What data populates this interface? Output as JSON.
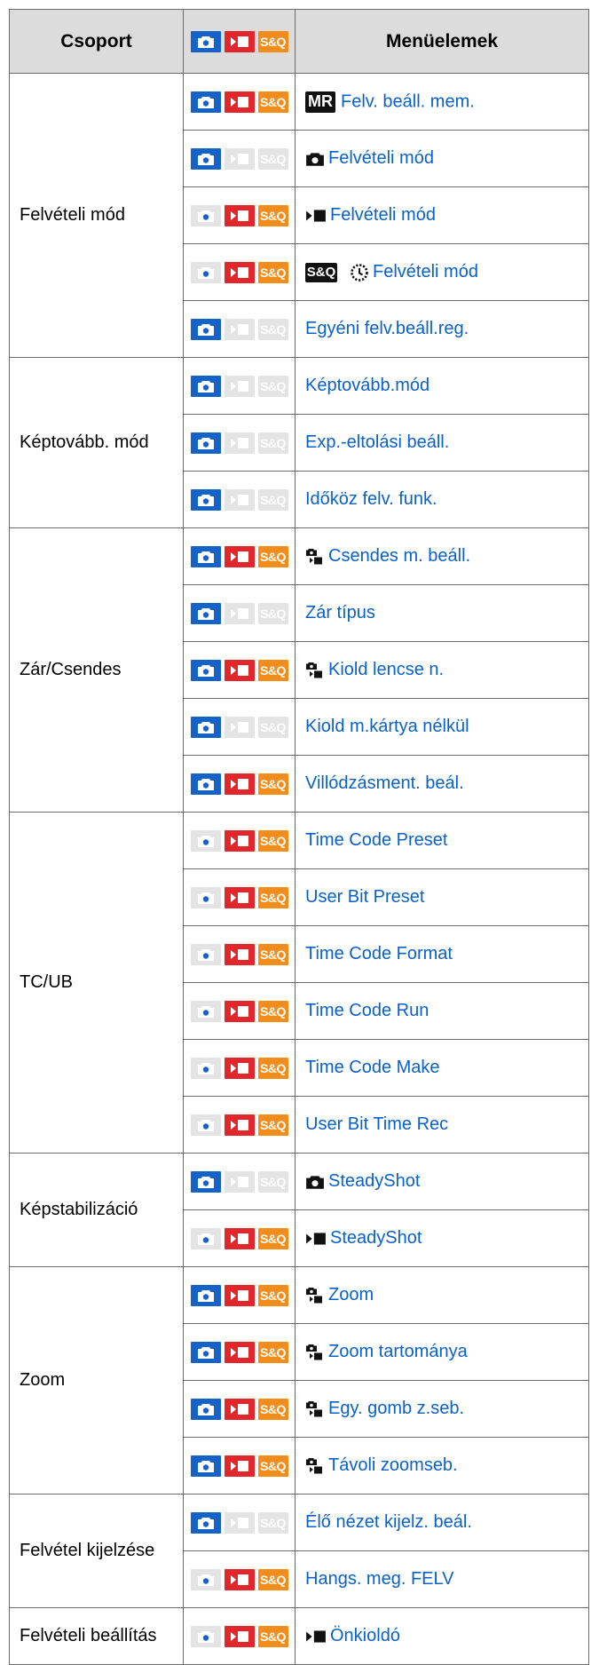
{
  "header": {
    "group": "Csoport",
    "modes": [
      "camera-icon",
      "movie-icon",
      "S&Q"
    ],
    "items": "Menüelemek"
  },
  "mode_colors": {
    "photo": "#1563c8",
    "movie": "#e3262b",
    "sq": "#f28c1a",
    "inactive": "#e4e4e4"
  },
  "groups": [
    {
      "label": "Felvételi mód",
      "rows": [
        {
          "modes": [
            true,
            true,
            true
          ],
          "prefix": [
            "MR"
          ],
          "text": "Felv. beáll. mem."
        },
        {
          "modes": [
            true,
            false,
            false
          ],
          "prefix": [
            "camera-icon"
          ],
          "text": "Felvételi mód"
        },
        {
          "modes": [
            false,
            true,
            true
          ],
          "prefix": [
            "movie-icon"
          ],
          "text": "Felvételi mód"
        },
        {
          "modes": [
            false,
            true,
            true
          ],
          "prefix": [
            "S&Q",
            "slow-quick-dial-icon"
          ],
          "text": "Felvételi mód"
        },
        {
          "modes": [
            true,
            false,
            false
          ],
          "prefix": [],
          "text": "Egyéni felv.beáll.reg."
        }
      ]
    },
    {
      "label": "Képtovább. mód",
      "rows": [
        {
          "modes": [
            true,
            false,
            false
          ],
          "prefix": [],
          "text": "Képtovább.mód"
        },
        {
          "modes": [
            true,
            false,
            false
          ],
          "prefix": [],
          "text": "Exp.-eltolási beáll."
        },
        {
          "modes": [
            true,
            false,
            false
          ],
          "prefix": [],
          "text": "Időköz felv. funk."
        }
      ]
    },
    {
      "label": "Zár/Csendes",
      "rows": [
        {
          "modes": [
            true,
            true,
            true
          ],
          "prefix": [
            "camera-movie-icon"
          ],
          "text": "Csendes m. beáll."
        },
        {
          "modes": [
            true,
            false,
            false
          ],
          "prefix": [],
          "text": "Zár típus"
        },
        {
          "modes": [
            true,
            true,
            true
          ],
          "prefix": [
            "camera-movie-icon"
          ],
          "text": "Kiold lencse n."
        },
        {
          "modes": [
            true,
            false,
            false
          ],
          "prefix": [],
          "text": "Kiold m.kártya nélkül"
        },
        {
          "modes": [
            true,
            true,
            true
          ],
          "prefix": [],
          "text": "Villódzásment. beál."
        }
      ]
    },
    {
      "label": "TC/UB",
      "rows": [
        {
          "modes": [
            false,
            true,
            true
          ],
          "prefix": [],
          "text": "Time Code Preset"
        },
        {
          "modes": [
            false,
            true,
            true
          ],
          "prefix": [],
          "text": "User Bit Preset"
        },
        {
          "modes": [
            false,
            true,
            true
          ],
          "prefix": [],
          "text": "Time Code Format"
        },
        {
          "modes": [
            false,
            true,
            true
          ],
          "prefix": [],
          "text": "Time Code Run"
        },
        {
          "modes": [
            false,
            true,
            true
          ],
          "prefix": [],
          "text": "Time Code Make"
        },
        {
          "modes": [
            false,
            true,
            true
          ],
          "prefix": [],
          "text": "User Bit Time Rec"
        }
      ]
    },
    {
      "label": "Képstabilizáció",
      "rows": [
        {
          "modes": [
            true,
            false,
            false
          ],
          "prefix": [
            "camera-icon"
          ],
          "text": "SteadyShot"
        },
        {
          "modes": [
            false,
            true,
            true
          ],
          "prefix": [
            "movie-icon"
          ],
          "text": "SteadyShot"
        }
      ]
    },
    {
      "label": "Zoom",
      "rows": [
        {
          "modes": [
            true,
            true,
            true
          ],
          "prefix": [
            "camera-movie-icon"
          ],
          "text": "Zoom"
        },
        {
          "modes": [
            true,
            true,
            true
          ],
          "prefix": [
            "camera-movie-icon"
          ],
          "text": "Zoom tartománya"
        },
        {
          "modes": [
            true,
            true,
            true
          ],
          "prefix": [
            "camera-movie-icon"
          ],
          "text": "Egy. gomb z.seb."
        },
        {
          "modes": [
            true,
            true,
            true
          ],
          "prefix": [
            "camera-movie-icon"
          ],
          "text": "Távoli zoomseb."
        }
      ]
    },
    {
      "label": "Felvétel kijelzése",
      "rows": [
        {
          "modes": [
            true,
            false,
            false
          ],
          "prefix": [],
          "text": "Élő nézet kijelz. beál."
        },
        {
          "modes": [
            false,
            true,
            true
          ],
          "prefix": [],
          "text": "Hangs. meg. FELV"
        }
      ]
    },
    {
      "label": "Felvételi beállítás",
      "rows": [
        {
          "modes": [
            false,
            true,
            true
          ],
          "prefix": [
            "movie-icon"
          ],
          "text": "Önkioldó"
        }
      ]
    }
  ]
}
